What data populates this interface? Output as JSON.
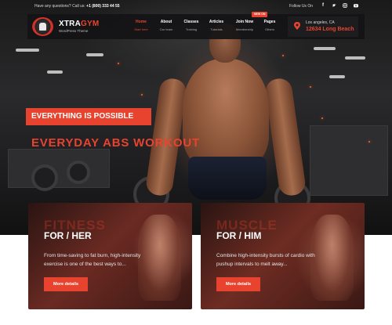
{
  "header": {
    "question_prefix": "Have any questions? Call us:",
    "phone": "+1 (800) 333 44 55",
    "follow_label": "Follow Us On",
    "social_icons": [
      "facebook-icon",
      "twitter-icon",
      "instagram-icon",
      "youtube-icon"
    ]
  },
  "logo": {
    "name_white": "XTRA",
    "name_accent": "GYM",
    "tagline": "WordPress Theme"
  },
  "nav": {
    "items": [
      {
        "label": "Home",
        "sub": "Start here",
        "active": true
      },
      {
        "label": "About",
        "sub": "Our team",
        "active": false
      },
      {
        "label": "Classes",
        "sub": "Training",
        "active": false
      },
      {
        "label": "Articles",
        "sub": "Tutorials",
        "active": false
      },
      {
        "label": "Join Now",
        "sub": "Membership",
        "active": false
      },
      {
        "label": "Pages",
        "sub": "Others",
        "active": false
      }
    ],
    "new_badge": "NEW ON"
  },
  "location": {
    "city": "Los angeles, CA",
    "address": "12634 Long Beach"
  },
  "hero": {
    "badge": "EVERYTHING IS POSSIBLE",
    "title": "EVERYDAY ABS WORKOUT"
  },
  "cards": [
    {
      "bigword": "FITNESS",
      "subtitle": "FOR / HER",
      "description": "From time-saving to fat burn, high-intensity exercise is one of the best ways to...",
      "button": "More details"
    },
    {
      "bigword": "MUSCLE",
      "subtitle": "FOR / HIM",
      "description": "Combine high-intensity bursts of cardio with pushup intervals to melt away...",
      "button": "More details"
    }
  ],
  "colors": {
    "accent": "#e8432e",
    "nav_bg": "#141416",
    "text_white": "#ffffff"
  }
}
